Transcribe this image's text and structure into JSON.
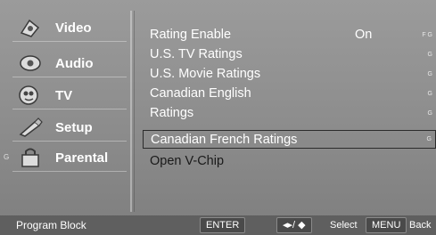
{
  "sidebar": {
    "items": [
      {
        "label": "Video",
        "icon": "video-icon"
      },
      {
        "label": "Audio",
        "icon": "audio-icon"
      },
      {
        "label": "TV",
        "icon": "tv-icon"
      },
      {
        "label": "Setup",
        "icon": "setup-icon"
      },
      {
        "label": "Parental",
        "icon": "parental-lock-icon"
      }
    ],
    "marker": "G"
  },
  "menu": {
    "rows": [
      {
        "label": "Rating Enable",
        "value": "On",
        "edge": "F G"
      },
      {
        "label": "U.S. TV Ratings",
        "value": "",
        "edge": "G"
      },
      {
        "label": "U.S. Movie Ratings",
        "value": "",
        "edge": "G"
      },
      {
        "label": "Canadian English",
        "value": "",
        "edge": "G"
      },
      {
        "label": "Ratings",
        "value": "",
        "edge": "G"
      },
      {
        "label": "Canadian French Ratings",
        "value": "",
        "edge": "G"
      },
      {
        "label": "Open V-Chip",
        "value": "",
        "edge": ""
      }
    ],
    "selected_index": 5
  },
  "footer": {
    "title": "Program Block",
    "enter_label": "ENTER",
    "nav_label": "◂▸/ ◆",
    "select_label": "Select",
    "menu_label": "MENU",
    "back_label": "Back"
  },
  "colors": {
    "background": "#8c8c8c",
    "footer": "#5f5f5f",
    "text": "#ffffff"
  }
}
